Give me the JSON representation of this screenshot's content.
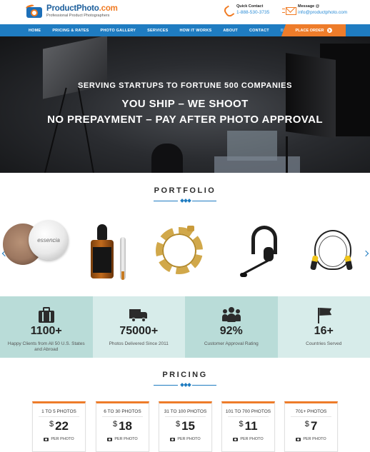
{
  "header": {
    "logo": {
      "name_main": "ProductPhoto",
      "name_dot": ".com",
      "tagline": "Professional Product Photographers"
    },
    "quick_contact": {
      "label": "Quick Contact",
      "value": "1-888-530-3735",
      "icon": "phone-icon"
    },
    "message": {
      "label": "Message @",
      "value": "info@productphoto.com",
      "icon": "mail-icon"
    }
  },
  "nav": {
    "items": [
      "HOME",
      "PRICING & RATES",
      "PHOTO GALLERY",
      "SERVICES",
      "HOW IT WORKS",
      "ABOUT",
      "CONTACT",
      "BLOG"
    ],
    "cta": "PLACE ORDER"
  },
  "hero": {
    "subtitle": "SERVING STARTUPS TO FORTUNE 500 COMPANIES",
    "line1": "YOU SHIP – WE SHOOT",
    "line2": "NO PREPAYMENT – PAY AFTER PHOTO APPROVAL"
  },
  "portfolio": {
    "title": "PORTFOLIO",
    "jar_text": "essencia",
    "items": [
      "makeup-powder",
      "serum-bottle",
      "gold-chain",
      "headset",
      "jump-rope"
    ]
  },
  "stats": [
    {
      "icon": "briefcase-icon",
      "number": "1100+",
      "caption": "Happy Clients from All 50 U.S. States and Abroad"
    },
    {
      "icon": "truck-icon",
      "number": "75000+",
      "caption": "Photos Delivered Since 2011"
    },
    {
      "icon": "users-icon",
      "number": "92%",
      "caption": "Customer Approval Rating"
    },
    {
      "icon": "flag-icon",
      "number": "16+",
      "caption": "Countries Served"
    }
  ],
  "pricing": {
    "title": "PRICING",
    "currency": "$",
    "per_label": "PER PHOTO",
    "cards": [
      {
        "range": "1 TO 5 PHOTOS",
        "price": "22"
      },
      {
        "range": "6 TO 30 PHOTOS",
        "price": "18"
      },
      {
        "range": "31 TO 100 PHOTOS",
        "price": "15"
      },
      {
        "range": "101 TO 700 PHOTOS",
        "price": "11"
      },
      {
        "range": "701+ PHOTOS",
        "price": "7"
      }
    ]
  },
  "colors": {
    "brand_blue": "#1f7cc1",
    "accent_orange": "#ee7c2a",
    "stat_teal": "#b9dcd8",
    "stat_teal_light": "#d7ecea"
  }
}
